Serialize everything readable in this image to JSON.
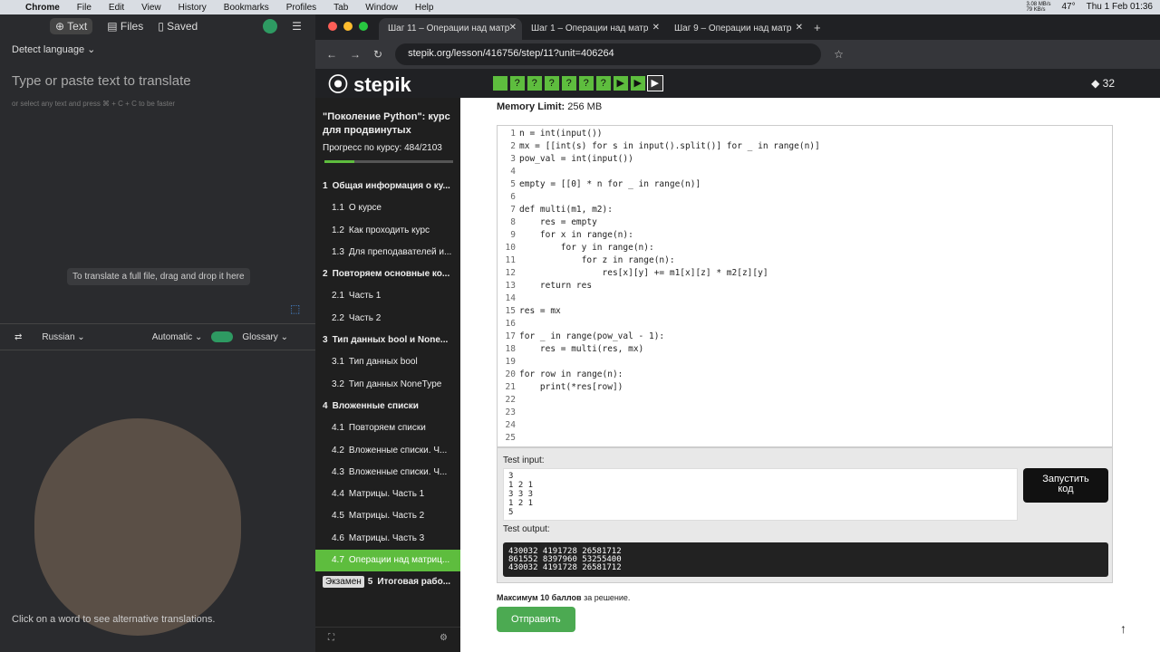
{
  "menubar": {
    "app": "Chrome",
    "items": [
      "File",
      "Edit",
      "View",
      "History",
      "Bookmarks",
      "Profiles",
      "Tab",
      "Window",
      "Help"
    ],
    "status": {
      "speed": "3.08 MB/s\n79 KB/s",
      "temp": "47°",
      "datetime": "Thu 1 Feb 01:36"
    }
  },
  "translator": {
    "tabs": [
      "Text",
      "Files",
      "Saved"
    ],
    "detect": "Detect language",
    "placeholder": "Type or paste text to translate",
    "hint": "or select any text and press ⌘ + C + C to be faster",
    "drop": "To translate a full file, drag and drop it here",
    "target_lang": "Russian",
    "mode": "Automatic",
    "glossary": "Glossary",
    "footer": "Click on a word to see alternative translations."
  },
  "browser": {
    "tabs": [
      {
        "title": "Шаг 11 – Операции над матр",
        "active": true
      },
      {
        "title": "Шаг 1 – Операции над матр",
        "active": false
      },
      {
        "title": "Шаг 9 – Операции над матр",
        "active": false
      }
    ],
    "url": "stepik.org/lesson/416756/step/11?unit=406264"
  },
  "stepik": {
    "logo": "stepik",
    "points": "32",
    "course": {
      "title": "\"Поколение Python\": курс для продвинутых",
      "progress_label": "Прогресс по курсу:",
      "progress": "484/2103",
      "progress_fraction": 0.23
    },
    "toc": [
      {
        "num": "1",
        "label": "Общая информация о ку..."
      },
      {
        "num": "1.1",
        "label": "О курсе"
      },
      {
        "num": "1.2",
        "label": "Как проходить курс"
      },
      {
        "num": "1.3",
        "label": "Для преподавателей и..."
      },
      {
        "num": "2",
        "label": "Повторяем основные ко..."
      },
      {
        "num": "2.1",
        "label": "Часть 1"
      },
      {
        "num": "2.2",
        "label": "Часть 2"
      },
      {
        "num": "3",
        "label": "Тип данных bool и None..."
      },
      {
        "num": "3.1",
        "label": "Тип данных bool"
      },
      {
        "num": "3.2",
        "label": "Тип данных NoneType"
      },
      {
        "num": "4",
        "label": "Вложенные списки"
      },
      {
        "num": "4.1",
        "label": "Повторяем списки"
      },
      {
        "num": "4.2",
        "label": "Вложенные списки. Ч..."
      },
      {
        "num": "4.3",
        "label": "Вложенные списки. Ч..."
      },
      {
        "num": "4.4",
        "label": "Матрицы. Часть 1"
      },
      {
        "num": "4.5",
        "label": "Матрицы. Часть 2"
      },
      {
        "num": "4.6",
        "label": "Матрицы. Часть 3"
      },
      {
        "num": "4.7",
        "label": "Операции над матриц..."
      },
      {
        "num": "5",
        "label": "Итоговая рабо..."
      }
    ],
    "exam": "Экзамен",
    "memory_label": "Memory Limit:",
    "memory": "256 MB",
    "code_lines": [
      "n = int(input())",
      "mx = [[int(s) for s in input().split()] for _ in range(n)]",
      "pow_val = int(input())",
      "",
      "empty = [[0] * n for _ in range(n)]",
      "",
      "def multi(m1, m2):",
      "    res = empty",
      "    for x in range(n):",
      "        for y in range(n):",
      "            for z in range(n):",
      "                res[x][y] += m1[x][z] * m2[z][y]",
      "    return res",
      "",
      "res = mx",
      "",
      "for _ in range(pow_val - 1):",
      "    res = multi(res, mx)",
      "",
      "for row in range(n):",
      "    print(*res[row])",
      "",
      "",
      "",
      ""
    ],
    "test_input_label": "Test input:",
    "test_input": "3\n1 2 1\n3 3 3\n1 2 1\n5",
    "run_button": "Запустить код",
    "test_output_label": "Test output:",
    "test_output": "430032 4191728 26581712\n861552 8397960 53255400\n430032 4191728 26581712",
    "max_score": "Максимум 10 баллов",
    "max_score_suffix": "за решение.",
    "submit": "Отправить"
  }
}
